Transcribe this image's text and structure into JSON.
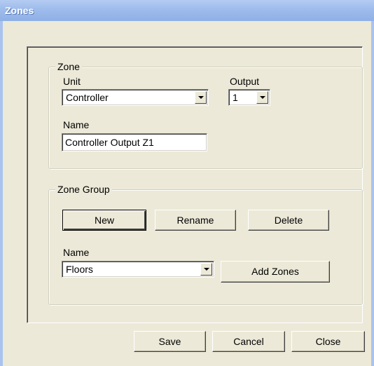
{
  "window": {
    "title": "Zones"
  },
  "zone": {
    "legend": "Zone",
    "unit_label": "Unit",
    "unit_value": "Controller",
    "output_label": "Output",
    "output_value": "1",
    "name_label": "Name",
    "name_value": "Controller Output Z1"
  },
  "zone_group": {
    "legend": "Zone Group",
    "new_label": "New",
    "rename_label": "Rename",
    "delete_label": "Delete",
    "name_label": "Name",
    "name_value": "Floors",
    "add_zones_label": "Add Zones"
  },
  "footer": {
    "save_label": "Save",
    "cancel_label": "Cancel",
    "close_label": "Close"
  },
  "icons": {
    "dropdown": "chevron-down-icon"
  }
}
